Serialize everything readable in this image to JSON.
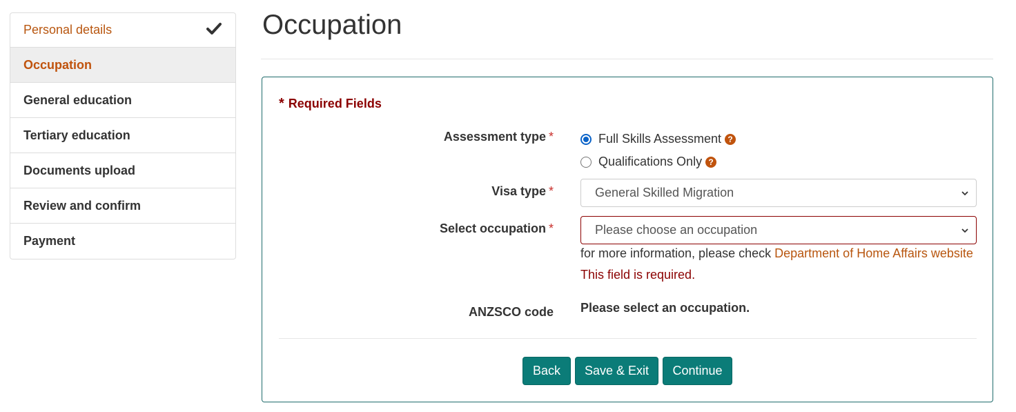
{
  "sidebar": {
    "items": [
      {
        "label": "Personal details"
      },
      {
        "label": "Occupation"
      },
      {
        "label": "General education"
      },
      {
        "label": "Tertiary education"
      },
      {
        "label": "Documents upload"
      },
      {
        "label": "Review and confirm"
      },
      {
        "label": "Payment"
      }
    ]
  },
  "page": {
    "title": "Occupation"
  },
  "form": {
    "required_star": "*",
    "required_text": "Required Fields",
    "assessment_type": {
      "label": "Assessment type",
      "req": "*",
      "options": [
        "Full Skills Assessment",
        "Qualifications Only"
      ],
      "selected": "Full Skills Assessment"
    },
    "visa_type": {
      "label": "Visa type",
      "req": "*",
      "value": "General Skilled Migration"
    },
    "occupation": {
      "label": "Select occupation",
      "req": "*",
      "placeholder": "Please choose an occupation",
      "info_prefix": "for more information, please check ",
      "info_link": "Department of Home Affairs website",
      "error": "This field is required."
    },
    "anzsco": {
      "label": "ANZSCO code",
      "value": "Please select an occupation."
    },
    "buttons": {
      "back": "Back",
      "save_exit": "Save & Exit",
      "continue": "Continue"
    }
  },
  "colors": {
    "accent": "#c0530d",
    "button": "#0b7c78",
    "error": "#8b0000",
    "panel_border": "#1f6b6b"
  }
}
